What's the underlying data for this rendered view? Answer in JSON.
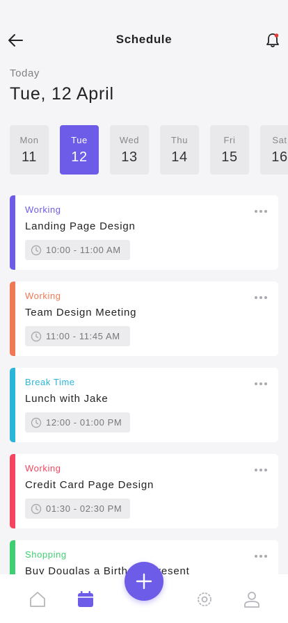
{
  "header": {
    "title": "Schedule"
  },
  "today": {
    "label": "Today",
    "date": "Tue, 12 April"
  },
  "days": [
    {
      "name": "Mon",
      "num": "11"
    },
    {
      "name": "Tue",
      "num": "12"
    },
    {
      "name": "Wed",
      "num": "13"
    },
    {
      "name": "Thu",
      "num": "14"
    },
    {
      "name": "Fri",
      "num": "15"
    },
    {
      "name": "Sat",
      "num": "16"
    }
  ],
  "selected_day": "Tue",
  "events": [
    {
      "category": "Working",
      "title": "Landing Page Design",
      "time": "10:00 - 11:00 AM",
      "color": "#6c5ce7"
    },
    {
      "category": "Working",
      "title": "Team Design Meeting",
      "time": "11:00 - 11:45 AM",
      "color": "#f07855"
    },
    {
      "category": "Break Time",
      "title": "Lunch with Jake",
      "time": "12:00 - 01:00 PM",
      "color": "#2bb5d8"
    },
    {
      "category": "Working",
      "title": "Credit Card Page Design",
      "time": "01:30 - 02:30 PM",
      "color": "#f5455e"
    },
    {
      "category": "Shopping",
      "title": "Buy Douglas a Birthday Present",
      "time": "",
      "color": "#3ecf73"
    }
  ],
  "colors": {
    "accent": "#6c5ce7",
    "notification_dot": "#e53935"
  },
  "nav": {
    "icons": [
      "home-icon",
      "calendar-icon",
      "add-icon",
      "settings-icon",
      "profile-icon"
    ]
  }
}
